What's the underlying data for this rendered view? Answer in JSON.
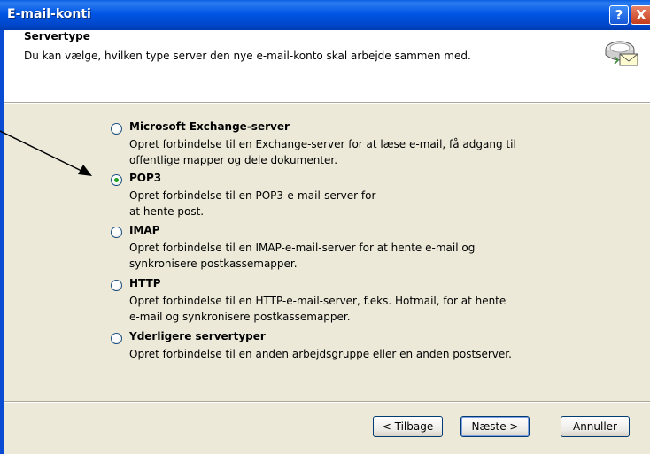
{
  "window": {
    "title": "E-mail-konti",
    "help_label": "?",
    "close_label": "X"
  },
  "header": {
    "title": "Servertype",
    "description": "Du kan vælge, hvilken type server den nye e-mail-konto skal arbejde sammen med.",
    "icon": "mail-server-icon"
  },
  "options": [
    {
      "label": "Microsoft Exchange-server",
      "desc_line1": "Opret forbindelse til en Exchange-server for at læse e-mail, få adgang til",
      "desc_line2": "offentlige mapper og dele dokumenter.",
      "selected": false
    },
    {
      "label": "POP3",
      "desc_line1": "Opret forbindelse til en POP3-e-mail-server for",
      "desc_line2": "at hente post.",
      "selected": true
    },
    {
      "label": "IMAP",
      "desc_line1": "Opret forbindelse til en IMAP-e-mail-server for at hente e-mail og",
      "desc_line2": "synkronisere postkassemapper.",
      "selected": false
    },
    {
      "label": "HTTP",
      "desc_line1": "Opret forbindelse til en HTTP-e-mail-server, f.eks. Hotmail, for at hente",
      "desc_line2": "e-mail og synkronisere postkassemapper.",
      "selected": false
    },
    {
      "label": "Yderligere servertyper",
      "desc_line1": "Opret forbindelse til en anden arbejdsgruppe eller en anden postserver.",
      "desc_line2": "",
      "selected": false
    }
  ],
  "buttons": {
    "back": "< Tilbage",
    "next": "Næste >",
    "cancel": "Annuller"
  },
  "colors": {
    "titlebar": "#0055e5",
    "dialog_bg": "#ece9d8",
    "radio_dot": "#21a121"
  }
}
